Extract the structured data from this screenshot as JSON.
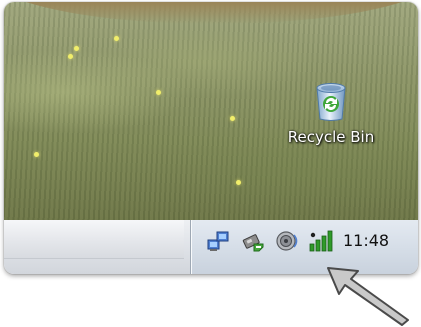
{
  "desktop": {
    "icons": [
      {
        "label": "Recycle Bin",
        "icon": "recycle-bin-icon"
      }
    ]
  },
  "taskbar": {
    "tray": {
      "icons": [
        "network-connection-icon",
        "safely-remove-hardware-icon",
        "volume-icon",
        "signal-strength-icon"
      ],
      "clock": "11:48"
    }
  },
  "annotation": {
    "icon": "pointer-arrow-icon"
  },
  "colors": {
    "signal_green": "#2f9a2a",
    "tray_background": "#d6dee8",
    "arrow_fill": "#c9c9c9",
    "arrow_stroke": "#4a4a4a"
  }
}
